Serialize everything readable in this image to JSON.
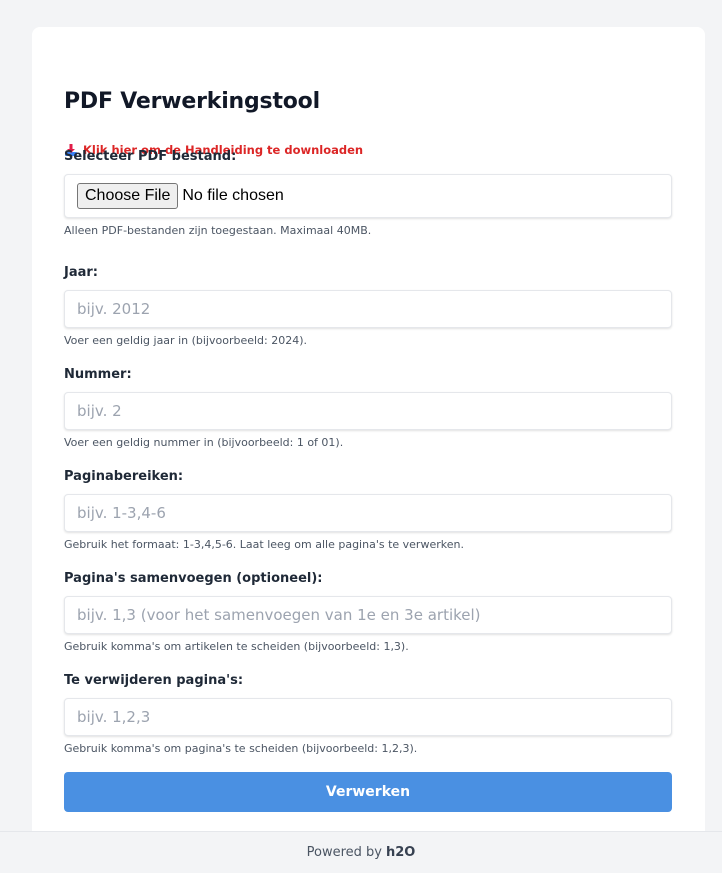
{
  "header": {
    "title": "PDF Verwerkingstool",
    "manual_link": "Klik hier om de Handleiding te downloaden"
  },
  "form": {
    "file": {
      "label": "Selecteer PDF bestand:",
      "button": "Choose File",
      "status": "No file chosen",
      "help": "Alleen PDF-bestanden zijn toegestaan. Maximaal 40MB."
    },
    "year": {
      "label": "Jaar:",
      "placeholder": "bijv. 2012",
      "value": "",
      "help": "Voer een geldig jaar in (bijvoorbeeld: 2024)."
    },
    "number": {
      "label": "Nummer:",
      "placeholder": "bijv. 2",
      "value": "",
      "help": "Voer een geldig nummer in (bijvoorbeeld: 1 of 01)."
    },
    "ranges": {
      "label": "Paginabereiken:",
      "placeholder": "bijv. 1-3,4-6",
      "value": "",
      "help": "Gebruik het formaat: 1-3,4,5-6. Laat leeg om alle pagina's te verwerken."
    },
    "merge": {
      "label": "Pagina's samenvoegen (optioneel):",
      "placeholder": "bijv. 1,3 (voor het samenvoegen van 1e en 3e artikel)",
      "value": "",
      "help": "Gebruik komma's om artikelen te scheiden (bijvoorbeeld: 1,3)."
    },
    "remove": {
      "label": "Te verwijderen pagina's:",
      "placeholder": "bijv. 1,2,3",
      "value": "",
      "help": "Gebruik komma's om pagina's te scheiden (bijvoorbeeld: 1,2,3)."
    },
    "submit_label": "Verwerken"
  },
  "footer": {
    "prefix": "Powered by",
    "brand": "h2O"
  },
  "colors": {
    "primary_button": "#4a90e2",
    "link_red": "#dc2626",
    "background": "#f3f4f6"
  },
  "icons": {
    "manual": "download-icon"
  }
}
